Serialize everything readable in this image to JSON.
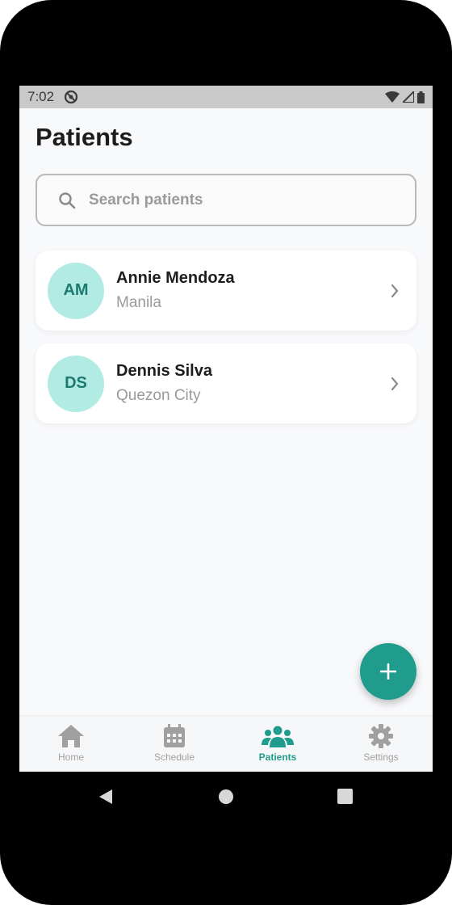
{
  "status_bar": {
    "time": "7:02"
  },
  "page": {
    "title": "Patients"
  },
  "search": {
    "placeholder": "Search patients"
  },
  "patients": [
    {
      "initials": "AM",
      "name": "Annie Mendoza",
      "city": "Manila"
    },
    {
      "initials": "DS",
      "name": "Dennis Silva",
      "city": "Quezon City"
    }
  ],
  "bottom_nav": {
    "items": [
      {
        "label": "Home",
        "icon": "home-icon"
      },
      {
        "label": "Schedule",
        "icon": "calendar-icon"
      },
      {
        "label": "Patients",
        "icon": "people-icon",
        "active": true
      },
      {
        "label": "Settings",
        "icon": "gear-icon"
      }
    ]
  },
  "colors": {
    "accent": "#1f9c8b",
    "avatar_bg": "#b2ebe4",
    "avatar_text": "#1d7a70",
    "inactive": "#a0a0a0"
  }
}
